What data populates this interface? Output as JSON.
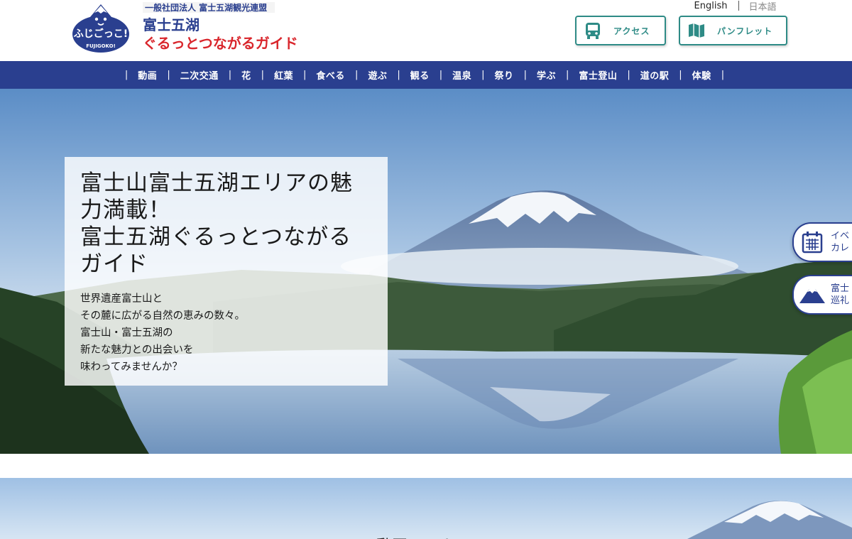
{
  "header": {
    "org_name": "一般社団法人 富士五湖観光連盟",
    "logo_mascot_text": "ふじごっこ!",
    "logo_mascot_sub": "FUJIGOKO!",
    "site_title_line1": "富士五湖",
    "site_title_line2": "ぐるっとつながるガイド",
    "lang_english": "English",
    "lang_japanese": "日本語",
    "access_label": "アクセス",
    "pamphlet_label": "パンフレット",
    "access_icon": "bus-icon",
    "pamphlet_icon": "map-icon"
  },
  "nav": {
    "items": [
      "動画",
      "二次交通",
      "花",
      "紅葉",
      "食べる",
      "遊ぶ",
      "観る",
      "温泉",
      "祭り",
      "学ぶ",
      "富士登山",
      "道の駅",
      "体験"
    ]
  },
  "hero": {
    "title_lines": [
      "富士山富士五湖エリアの魅",
      "力満載！",
      "富士五湖ぐるっとつながる",
      "ガイド"
    ],
    "text_lines": [
      "世界遺産富士山と",
      "その麓に広がる自然の恵みの数々。",
      "富士山・富士五湖の",
      "新たな魅力との出会いを",
      "味わってみませんか？"
    ]
  },
  "side_tabs": {
    "event_line1": "イベ",
    "event_line2": "カレ",
    "pilgrim_line1": "富士",
    "pilgrim_line2": "巡礼"
  },
  "below": {
    "partial_title": "動画コーナー"
  },
  "colors": {
    "nav_bg": "#2a3f8f",
    "button_accent": "#2e8b86",
    "logo_red": "#d9262c"
  }
}
